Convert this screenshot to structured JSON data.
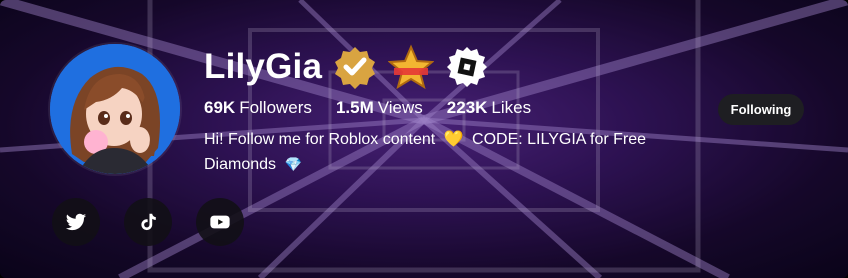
{
  "profile": {
    "name": "LilyGia",
    "badges": [
      "verified-badge-icon",
      "star-badge-icon",
      "roblox-badge-icon"
    ],
    "stats": [
      {
        "value": "69K",
        "label": "Followers"
      },
      {
        "value": "1.5M",
        "label": "Views"
      },
      {
        "value": "223K",
        "label": "Likes"
      }
    ],
    "bio_line1": "Hi! Follow me for Roblox content",
    "bio_heart": "💛",
    "bio_line2": "CODE: LILYGIA for Free Diamonds",
    "bio_gem": "💎"
  },
  "actions": {
    "follow_label": "Following"
  },
  "socials": [
    {
      "icon": "twitter-icon"
    },
    {
      "icon": "tiktok-icon"
    },
    {
      "icon": "youtube-icon"
    }
  ],
  "colors": {
    "background_purple": "#3a1769",
    "button_dark": "#1e1e22",
    "avatar_blue": "#1f6fe0",
    "heart_yellow": "#ffd400",
    "gem_cyan": "#6fd6ff"
  }
}
